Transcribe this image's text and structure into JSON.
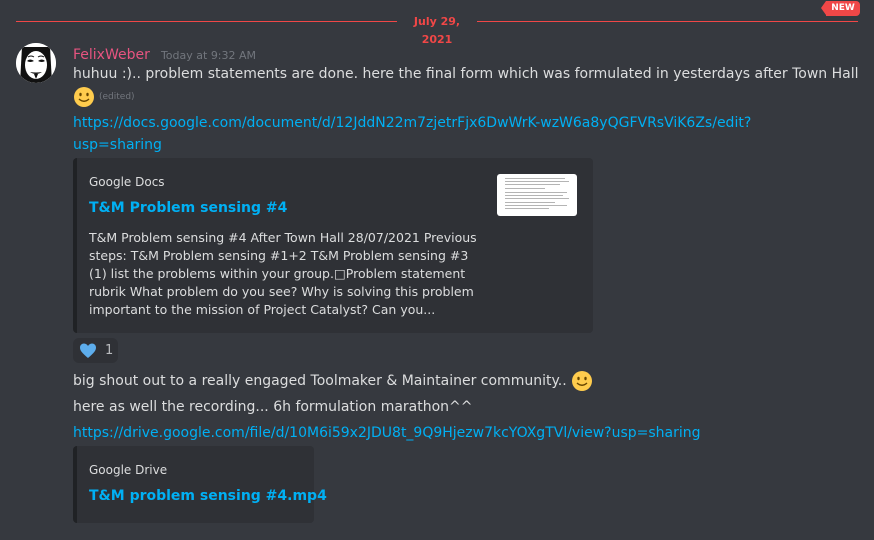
{
  "divider": {
    "date": "July 29, 2021",
    "new_label": "NEW"
  },
  "message": {
    "username": "FelixWeber",
    "timestamp": "Today at 9:32 AM",
    "lines": {
      "line1": "huhuu :).. problem statements are done. here the final form which was formulated in yesterdays after Town Hall",
      "edited": "(edited)",
      "link1_part1": "https://docs.google.com/document/d/12JddN22m7zjetrFjx6DwWrK-wzW6a8yQGFVRsViK6Zs/edit?",
      "link1_part2": "usp=sharing",
      "line_shout": "big shout out to a really engaged Toolmaker & Maintainer community..",
      "line_recording": "here as well the recording... 6h formulation marathon^^",
      "link2": "https://drive.google.com/file/d/10M6i59x2JDU8t_9Q9Hjezw7kcYOXgTVl/view?usp=sharing"
    },
    "emoji_names": {
      "smile": "slightly-smiling-face-icon",
      "heart": "blue-heart-icon"
    },
    "reaction": {
      "count": "1"
    }
  },
  "embed_docs": {
    "provider": "Google Docs",
    "title": "T&M Problem sensing #4",
    "description": "T&M Problem sensing #4 After Town Hall 28/07/2021 Previous steps: T&M Problem sensing #1+2 T&M Problem sensing #3 (1) list the problems within your group.□Problem statement rubrik What problem do you see? Why is solving this problem important to the mission of Project Catalyst? Can you..."
  },
  "embed_drive": {
    "provider": "Google Drive",
    "title": "T&M problem sensing #4.mp4"
  },
  "colors": {
    "background": "#36393f",
    "embed_bg": "#2f3136",
    "link": "#00b0f4",
    "username": "#e75480",
    "new_red": "#f04747"
  }
}
